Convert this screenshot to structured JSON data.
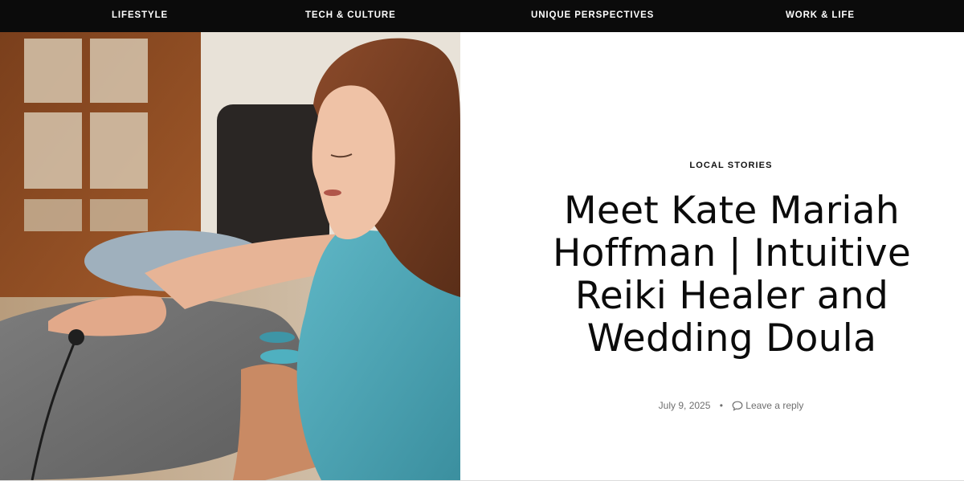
{
  "nav": {
    "items": [
      {
        "label": "LIFESTYLE"
      },
      {
        "label": "TECH & CULTURE"
      },
      {
        "label": "UNIQUE PERSPECTIVES"
      },
      {
        "label": "WORK & LIFE"
      }
    ]
  },
  "hero": {
    "category": "LOCAL STORIES",
    "title": "Meet Kate Mariah Hoffman | Intuitive Reiki Healer and Wedding Doula",
    "date": "July 9, 2025",
    "separator": "•",
    "reply_label": "Leave a reply",
    "reply_icon": "comment-icon"
  },
  "colors": {
    "nav_background": "#0b0b0b",
    "nav_text": "#ffffff",
    "headline": "#0b0b0b",
    "meta_text": "#6f6f6f",
    "shirt_teal": "#4aa3b3"
  }
}
